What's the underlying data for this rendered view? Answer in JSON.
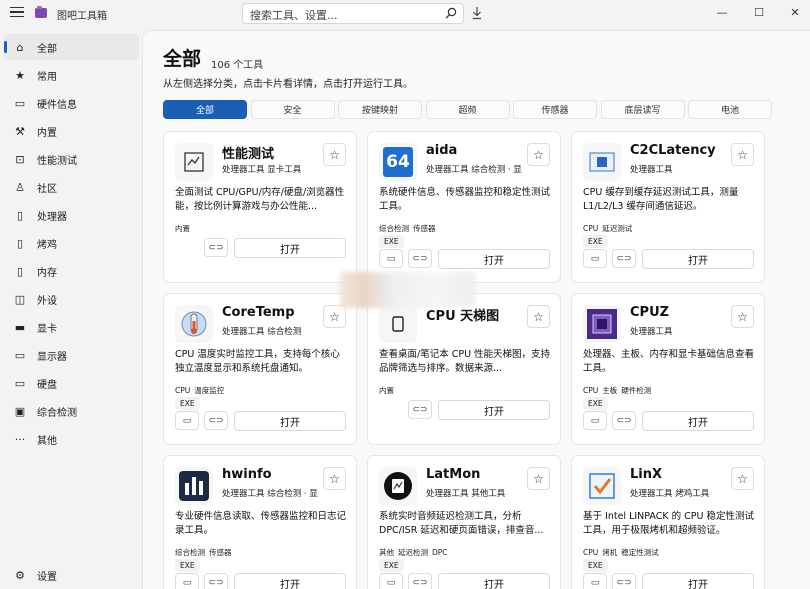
{
  "app": {
    "title": "图吧工具箱",
    "search_placeholder": "搜索工具、设置...",
    "accent": "#1a5fb4"
  },
  "window_controls": {
    "minimize": "—",
    "maximize": "☐",
    "close": "✕"
  },
  "sidebar": {
    "items": [
      {
        "label": "全部",
        "icon": "home-icon",
        "glyph": "⌂",
        "active": true
      },
      {
        "label": "常用",
        "icon": "star-icon",
        "glyph": "★"
      },
      {
        "label": "硬件信息",
        "icon": "hardware-icon",
        "glyph": "▭"
      },
      {
        "label": "内置",
        "icon": "wrench-icon",
        "glyph": "⚒"
      },
      {
        "label": "性能测试",
        "icon": "chart-icon",
        "glyph": "⊡"
      },
      {
        "label": "社区",
        "icon": "community-icon",
        "glyph": "♙"
      },
      {
        "label": "处理器",
        "icon": "cpu-icon",
        "glyph": "▯"
      },
      {
        "label": "烤鸡",
        "icon": "stress-icon",
        "glyph": "▯"
      },
      {
        "label": "内存",
        "icon": "memory-icon",
        "glyph": "▯"
      },
      {
        "label": "外设",
        "icon": "mouse-icon",
        "glyph": "◫"
      },
      {
        "label": "显卡",
        "icon": "gpu-icon",
        "glyph": "▬"
      },
      {
        "label": "显示器",
        "icon": "monitor-icon",
        "glyph": "▭"
      },
      {
        "label": "硬盘",
        "icon": "disk-icon",
        "glyph": "▭"
      },
      {
        "label": "综合检测",
        "icon": "diagnostic-icon",
        "glyph": "▣"
      },
      {
        "label": "其他",
        "icon": "more-icon",
        "glyph": "···"
      }
    ],
    "settings_label": "设置"
  },
  "main": {
    "title": "全部",
    "count": "106 个工具",
    "subtitle": "从左侧选择分类，点击卡片看详情，点击打开运行工具。",
    "filters": [
      "全部",
      "安全",
      "按键映射",
      "超频",
      "传感器",
      "底层读写",
      "电池"
    ],
    "open_label": "打开"
  },
  "cards": [
    {
      "title": "性能测试",
      "cats": "处理器工具 显卡工具",
      "desc": "全面测试 CPU/GPU/内存/硬盘/浏览器性能，按比例计算游戏与办公性能...",
      "tags": [
        "内置"
      ],
      "exe": "",
      "icon": "chart-tool-icon"
    },
    {
      "title": "aida",
      "cats": "处理器工具 综合检测 · 显",
      "desc": "系统硬件信息、传感器监控和稳定性测试工具。",
      "tags": [
        "综合检测",
        "传感器"
      ],
      "exe": "EXE",
      "icon": "aida64-icon",
      "icon_text": "64"
    },
    {
      "title": "C2CLatency",
      "cats": "处理器工具",
      "desc": "CPU 缓存到缓存延迟测试工具，测量 L1/L2/L3 缓存间通信延迟。",
      "tags": [
        "CPU",
        "延迟测试"
      ],
      "exe": "EXE",
      "icon": "c2c-icon"
    },
    {
      "title": "CoreTemp",
      "cats": "处理器工具 综合检测",
      "desc": "CPU 温度实时监控工具，支持每个核心独立温度显示和系统托盘通知。",
      "tags": [
        "CPU",
        "温度监控"
      ],
      "exe": "EXE",
      "icon": "coretemp-icon"
    },
    {
      "title": "CPU 天梯图",
      "cats": "",
      "desc": "查看桌面/笔记本 CPU 性能天梯图，支持品牌筛选与排序。数据来源...",
      "tags": [
        "内置"
      ],
      "exe": "",
      "icon": "ladder-icon"
    },
    {
      "title": "CPUZ",
      "cats": "处理器工具",
      "desc": "处理器、主板、内存和显卡基础信息查看工具。",
      "tags": [
        "CPU",
        "主板",
        "硬件检测"
      ],
      "exe": "EXE",
      "icon": "cpuz-icon"
    },
    {
      "title": "hwinfo",
      "cats": "处理器工具 综合检测 · 显",
      "desc": "专业硬件信息读取、传感器监控和日志记录工具。",
      "tags": [
        "综合检测",
        "传感器"
      ],
      "exe": "EXE",
      "icon": "hwinfo-icon"
    },
    {
      "title": "LatMon",
      "cats": "处理器工具 其他工具",
      "desc": "系统实时音频延迟检测工具，分析 DPC/ISR 延迟和硬页面错误，排查音...",
      "tags": [
        "其他",
        "延迟检测",
        "DPC"
      ],
      "exe": "EXE",
      "icon": "latmon-icon"
    },
    {
      "title": "LinX",
      "cats": "处理器工具 烤鸡工具",
      "desc": "基于 Intel LINPACK 的 CPU 稳定性测试工具，用于极限烤机和超频验证。",
      "tags": [
        "CPU",
        "烤机",
        "稳定性测试"
      ],
      "exe": "EXE",
      "icon": "linx-icon"
    }
  ]
}
